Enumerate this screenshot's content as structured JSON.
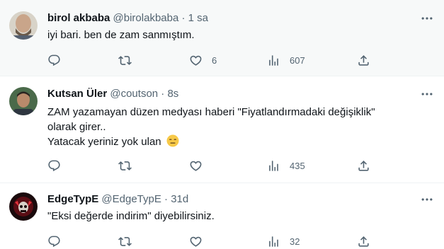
{
  "tweets": [
    {
      "name": "birol akbaba",
      "handle": "@birolakbaba",
      "sep": "·",
      "time": "1 sa",
      "lines": [
        "iyi bari. ben de zam sanmıştım."
      ],
      "reply_count": "",
      "retweet_count": "",
      "like_count": "6",
      "view_count": "607",
      "avatar_icon": "bald-man-avatar"
    },
    {
      "name": "Kutsan Üler",
      "handle": "@coutson",
      "sep": "·",
      "time": "8s",
      "lines": [
        "ZAM yazamayan  düzen medyası haberi \"Fiyatlandırmadaki değişiklik\"",
        "olarak girer..",
        "Yatacak yeriniz yok ulan"
      ],
      "emoji": "😑",
      "reply_count": "",
      "retweet_count": "",
      "like_count": "",
      "view_count": "435",
      "avatar_icon": "man-portrait-avatar"
    },
    {
      "name": "EdgeTypE",
      "handle": "@EdgeTypE",
      "sep": "·",
      "time": "31d",
      "lines": [
        "\"Eksi değerde indirim\" diyebilirsiniz."
      ],
      "reply_count": "",
      "retweet_count": "",
      "like_count": "",
      "view_count": "32",
      "avatar_icon": "red-skull-avatar"
    }
  ],
  "colors": {
    "text": "#0f1419",
    "muted": "#536471",
    "hover_bg": "#f7f9f9",
    "divider": "#eff3f4",
    "emoji": "#f7c948"
  }
}
